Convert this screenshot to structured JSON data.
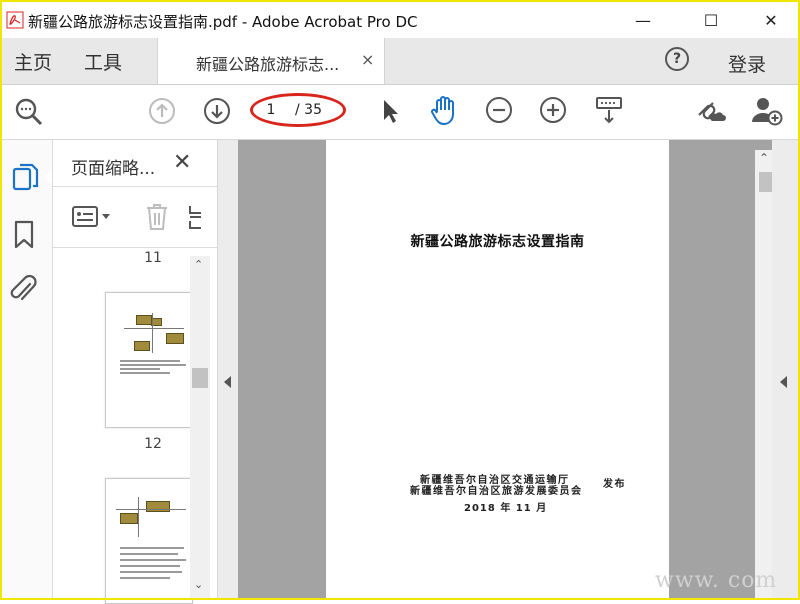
{
  "window": {
    "title": "新疆公路旅游标志设置指南.pdf - Adobe Acrobat Pro DC",
    "minimize_glyph": "—",
    "maximize_glyph": "☐",
    "close_glyph": "✕"
  },
  "menu": {
    "home": "主页",
    "tools": "工具",
    "doc_tab": "新疆公路旅游标志...",
    "doc_tab_close": "×",
    "help": "?",
    "login": "登录"
  },
  "toolbar": {
    "current_page": "1",
    "total_pages": "/ 35"
  },
  "thumbnails_panel": {
    "title": "页面缩略...",
    "close_glyph": "✕",
    "pages": [
      {
        "label": "11"
      },
      {
        "label": "12"
      }
    ]
  },
  "document": {
    "title": "新疆公路旅游标志设置指南",
    "publisher_1": "新疆维吾尔自治区交通运输厅",
    "publisher_2": "新疆维吾尔自治区旅游发展委员会",
    "publish_word": "发布",
    "date": "2018 年 11 月"
  },
  "watermark": "www.      com",
  "colors": {
    "accent_blue": "#1a73c8",
    "page_ellipse": "#d9261c",
    "frame": "#f2e600"
  }
}
